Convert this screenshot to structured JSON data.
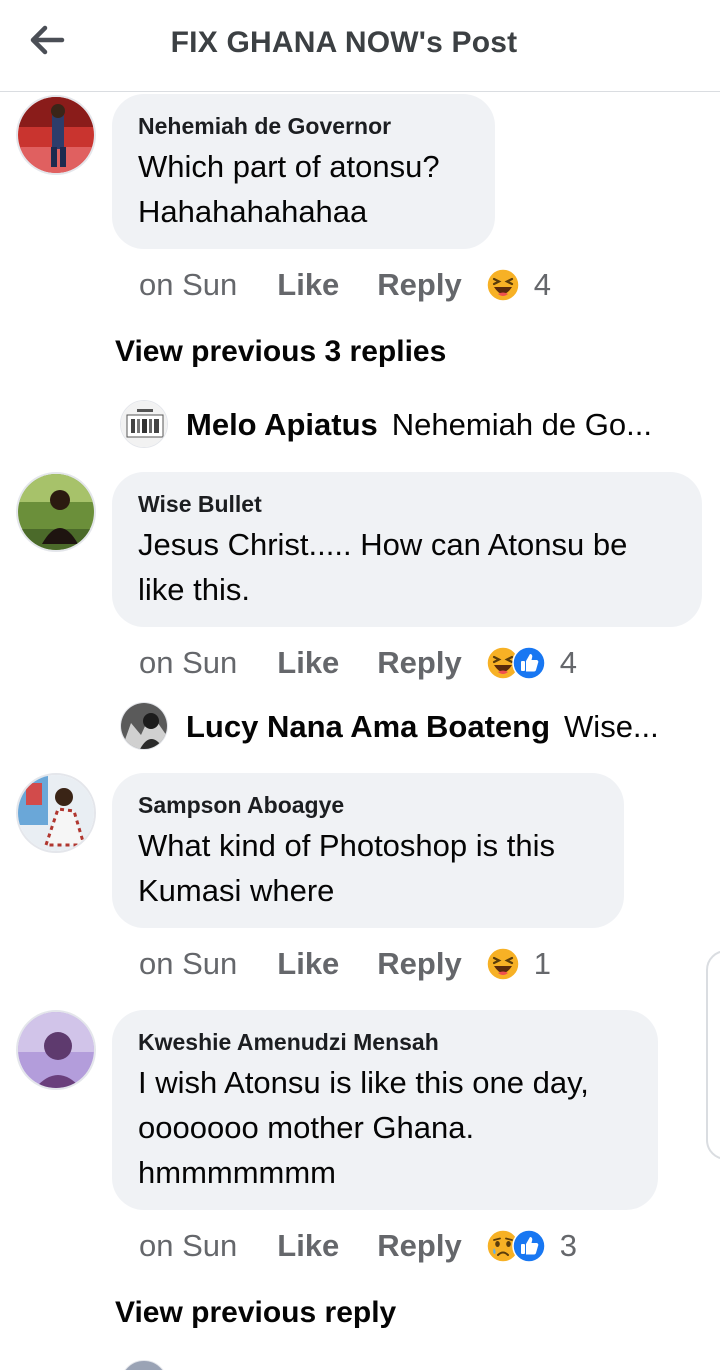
{
  "header": {
    "title": "FIX GHANA NOW's Post",
    "back_icon": "arrow-left-icon"
  },
  "comments": [
    {
      "author": "Nehemiah de Governor",
      "lines": [
        "Which part of atonsu?",
        "Hahahahahahaa"
      ],
      "time": "on Sun",
      "like": "Like",
      "reply": "Reply",
      "reactions": [
        "haha"
      ],
      "count": "4"
    },
    {
      "author": "Wise Bullet",
      "lines": [
        "Jesus Christ..... How can Atonsu be",
        "like this."
      ],
      "time": "on Sun",
      "like": "Like",
      "reply": "Reply",
      "reactions": [
        "haha",
        "like"
      ],
      "count": "4"
    },
    {
      "author": "Sampson Aboagye",
      "lines": [
        "What kind of Photoshop is this",
        "Kumasi where"
      ],
      "time": "on Sun",
      "like": "Like",
      "reply": "Reply",
      "reactions": [
        "haha"
      ],
      "count": "1"
    },
    {
      "author": "Kweshie Amenudzi Mensah",
      "lines": [
        "I wish Atonsu is like this one day,",
        "ooooooo mother Ghana.",
        "hmmmmmmm"
      ],
      "time": "on Sun",
      "like": "Like",
      "reply": "Reply",
      "reactions": [
        "sad",
        "like"
      ],
      "count": "3"
    }
  ],
  "view_previous": {
    "first": "View previous 3 replies",
    "second": "View previous reply"
  },
  "replies": [
    {
      "author": "Melo Apiatus",
      "text": "Nehemiah de Go..."
    },
    {
      "author": "Lucy Nana Ama Boateng",
      "text": "Wise..."
    }
  ],
  "colors": {
    "haha": "#f7b125",
    "like": "#1877f2",
    "muted": "#65676b",
    "bubble": "#f0f2f5"
  }
}
